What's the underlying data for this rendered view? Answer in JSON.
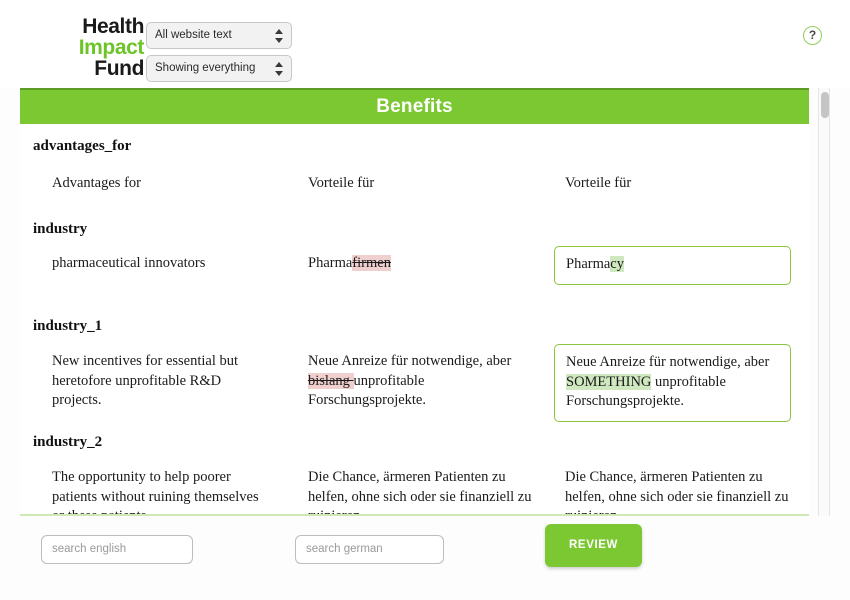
{
  "header": {
    "logo": {
      "line1": "Health",
      "line2": "Impact",
      "line3": "Fund",
      "accent_color": "#6cc428"
    },
    "scope_select": {
      "value": "All website text",
      "icon": "updown-arrows-icon"
    },
    "filter_select": {
      "value": "Showing everything",
      "icon": "updown-arrows-icon"
    },
    "help": {
      "label": "?",
      "icon": "question-mark-icon"
    }
  },
  "banner": {
    "title": "Benefits",
    "color": "#7bc832"
  },
  "entries": [
    {
      "key": "advantages_for",
      "english": "Advantages for",
      "german_parts": [
        {
          "text": "Vorteile für",
          "mark": "none"
        }
      ],
      "edited_parts": [
        {
          "text": "Vorteile für",
          "mark": "none"
        }
      ],
      "edited_boxed": false
    },
    {
      "key": "industry",
      "english": "pharmaceutical innovators",
      "german_parts": [
        {
          "text": "Pharma",
          "mark": "none"
        },
        {
          "text": "firmen",
          "mark": "deleted"
        }
      ],
      "edited_parts": [
        {
          "text": "Pharma",
          "mark": "none"
        },
        {
          "text": "cy",
          "mark": "added"
        }
      ],
      "edited_boxed": true
    },
    {
      "key": "industry_1",
      "english": "New incentives for essential but heretofore unprofitable R&D projects.",
      "german_parts": [
        {
          "text": "Neue Anreize für notwendige, aber ",
          "mark": "none"
        },
        {
          "text": "bislang ",
          "mark": "deleted"
        },
        {
          "text": "unprofitable Forschungsprojekte.",
          "mark": "none"
        }
      ],
      "edited_parts": [
        {
          "text": "Neue Anreize für notwendige, aber ",
          "mark": "none"
        },
        {
          "text": "SOMETHING",
          "mark": "added"
        },
        {
          "text": " unprofitable Forschungsprojekte.",
          "mark": "none"
        }
      ],
      "edited_boxed": true
    },
    {
      "key": "industry_2",
      "english": "The opportunity to help poorer patients without ruining themselves or these patients.",
      "german_parts": [
        {
          "text": "Die Chance, ärmeren Patienten zu helfen, ohne sich oder sie finanziell zu ruinieren.",
          "mark": "none"
        }
      ],
      "edited_parts": [
        {
          "text": "Die Chance, ärmeren Patienten zu helfen, ohne sich oder sie finanziell zu ruinieren.",
          "mark": "none"
        }
      ],
      "edited_boxed": false
    }
  ],
  "footer": {
    "search_english_placeholder": "search english",
    "search_english_value": "",
    "search_german_placeholder": "search german",
    "search_german_value": "",
    "review_label": "REVIEW",
    "review_color": "#7bc832"
  },
  "scrollbar": {
    "thumb_position_percent": 1
  }
}
